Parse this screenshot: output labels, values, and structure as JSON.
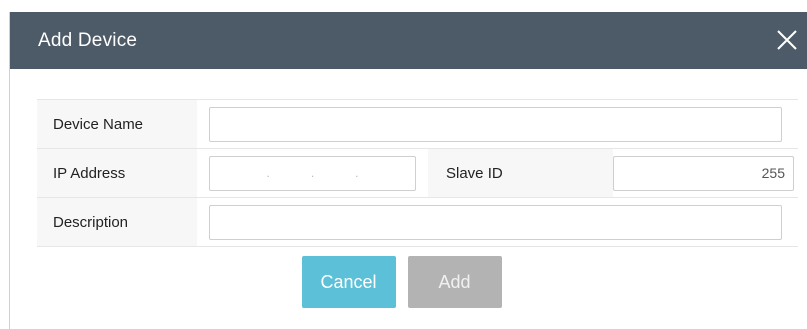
{
  "dialog": {
    "title": "Add Device",
    "close_icon": "close-icon"
  },
  "form": {
    "device_name": {
      "label": "Device Name",
      "value": ""
    },
    "ip_address": {
      "label": "IP Address",
      "octets": [
        "",
        "",
        "",
        ""
      ],
      "separator": "."
    },
    "slave_id": {
      "label": "Slave ID",
      "value": "255"
    },
    "description": {
      "label": "Description",
      "value": ""
    }
  },
  "actions": {
    "cancel_label": "Cancel",
    "add_label": "Add"
  },
  "colors": {
    "titlebar": "#4d5a67",
    "cancel": "#5bc0d8",
    "add_disabled": "#b3b3b3"
  }
}
